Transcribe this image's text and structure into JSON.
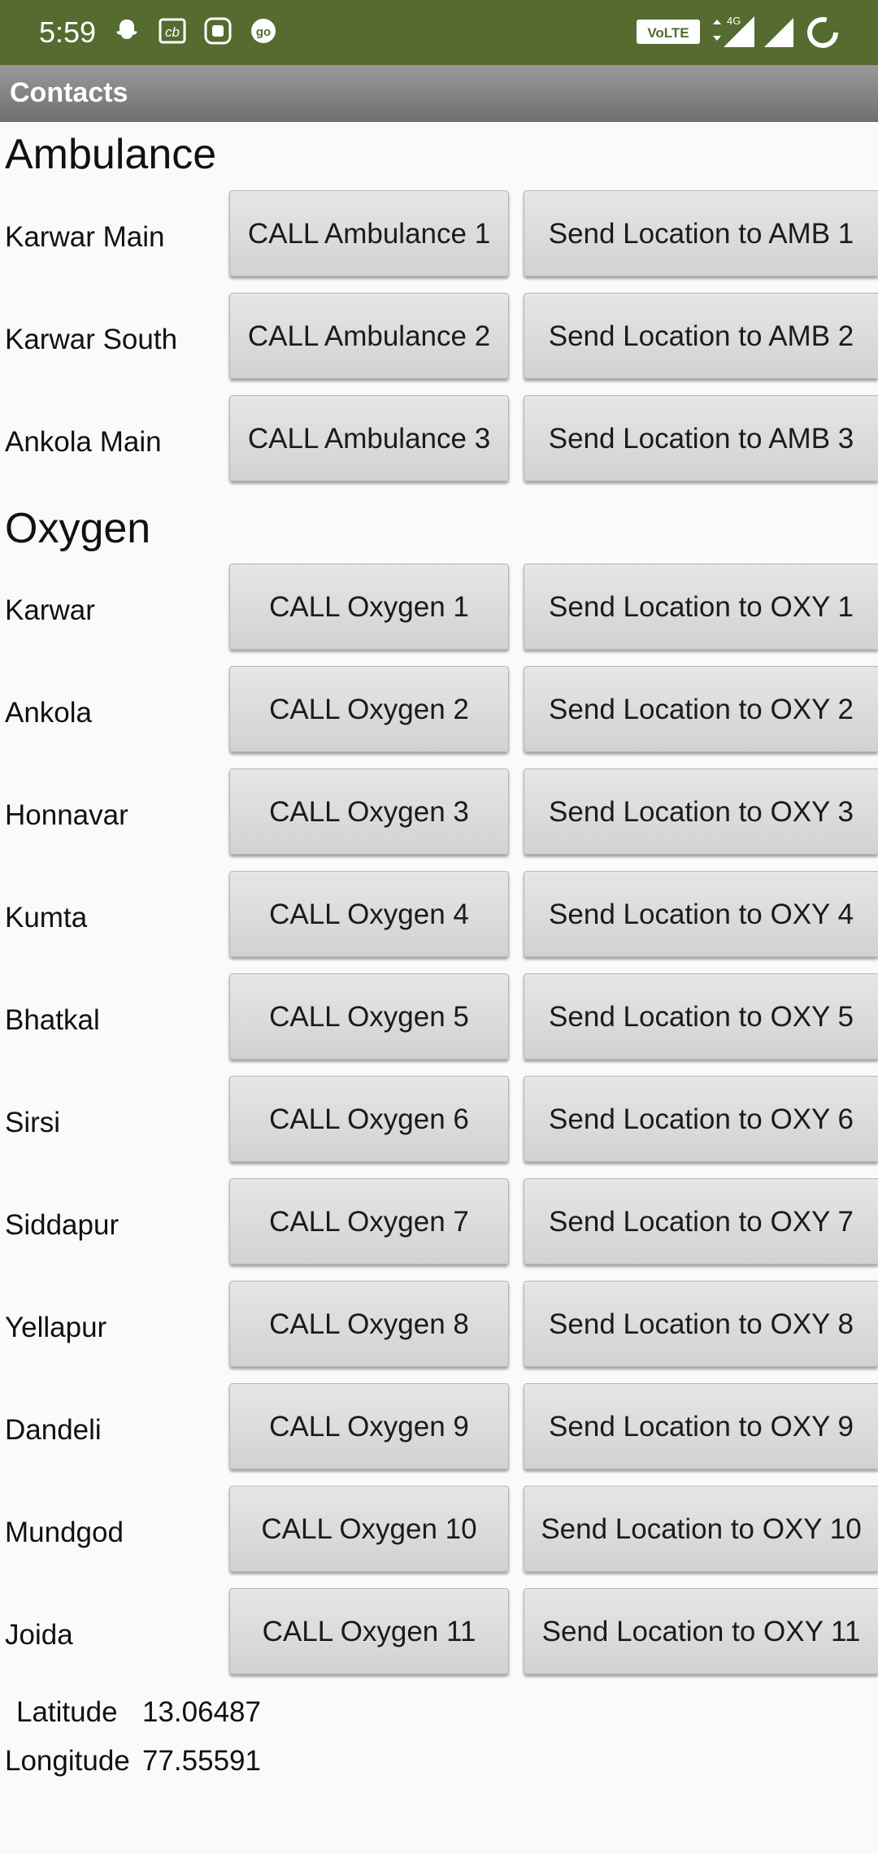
{
  "status_bar": {
    "time": "5:59",
    "left_icons": [
      "snapchat-icon",
      "cb-icon",
      "app-icon",
      "go-icon"
    ],
    "right_icons": [
      "volte-icon",
      "data-4g-icon",
      "signal-icon",
      "signal-icon",
      "loading-icon"
    ],
    "volte_label": "VoLTE",
    "net_label": "4G"
  },
  "app": {
    "title": "Contacts"
  },
  "ambulance": {
    "heading": "Ambulance",
    "rows": [
      {
        "label": "Karwar Main",
        "call": "CALL Ambulance 1",
        "send": "Send Location to AMB 1"
      },
      {
        "label": "Karwar South",
        "call": "CALL Ambulance 2",
        "send": "Send Location to AMB 2"
      },
      {
        "label": "Ankola Main",
        "call": "CALL Ambulance 3",
        "send": "Send Location to AMB 3"
      }
    ]
  },
  "oxygen": {
    "heading": "Oxygen",
    "rows": [
      {
        "label": "Karwar",
        "call": "CALL Oxygen 1",
        "send": "Send Location to OXY 1"
      },
      {
        "label": "Ankola",
        "call": "CALL Oxygen 2",
        "send": "Send Location to OXY 2"
      },
      {
        "label": "Honnavar",
        "call": "CALL Oxygen 3",
        "send": "Send Location to OXY 3"
      },
      {
        "label": "Kumta",
        "call": "CALL Oxygen 4",
        "send": "Send Location to OXY 4"
      },
      {
        "label": "Bhatkal",
        "call": "CALL Oxygen 5",
        "send": "Send Location to OXY 5"
      },
      {
        "label": "Sirsi",
        "call": "CALL Oxygen 6",
        "send": "Send Location to OXY 6"
      },
      {
        "label": "Siddapur",
        "call": "CALL Oxygen 7",
        "send": "Send Location to OXY 7"
      },
      {
        "label": "Yellapur",
        "call": "CALL Oxygen 8",
        "send": "Send Location to OXY 8"
      },
      {
        "label": "Dandeli",
        "call": "CALL Oxygen 9",
        "send": "Send Location to OXY 9"
      },
      {
        "label": "Mundgod",
        "call": "CALL Oxygen 10",
        "send": "Send Location to OXY 10"
      },
      {
        "label": "Joida",
        "call": "CALL Oxygen 11",
        "send": "Send Location to OXY 11"
      }
    ]
  },
  "location": {
    "latitude_label": "Latitude",
    "latitude_value": "13.06487",
    "longitude_label": "Longitude",
    "longitude_value": "77.55591"
  }
}
